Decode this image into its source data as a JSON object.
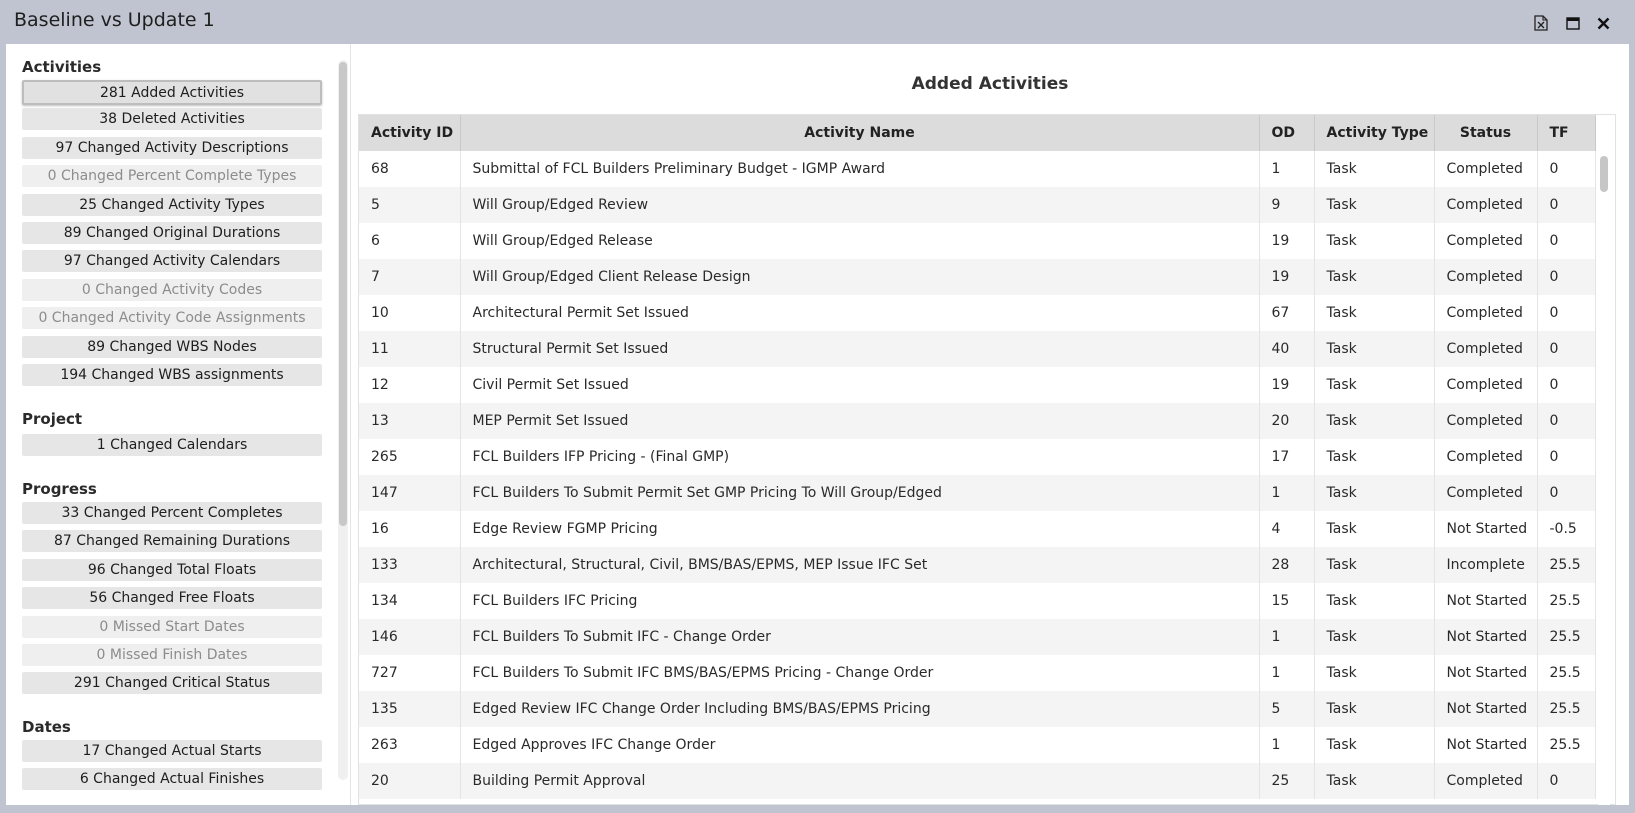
{
  "window": {
    "title": "Baseline vs Update 1"
  },
  "sidebar": {
    "sections": [
      {
        "heading": "Activities",
        "items": [
          {
            "label": "281 Added Activities",
            "state": "selected"
          },
          {
            "label": "38 Deleted Activities",
            "state": "enabled"
          },
          {
            "label": "97 Changed Activity Descriptions",
            "state": "enabled"
          },
          {
            "label": "0 Changed Percent Complete Types",
            "state": "disabled"
          },
          {
            "label": "25 Changed Activity Types",
            "state": "enabled"
          },
          {
            "label": "89 Changed Original Durations",
            "state": "enabled"
          },
          {
            "label": "97 Changed Activity Calendars",
            "state": "enabled"
          },
          {
            "label": "0 Changed Activity Codes",
            "state": "disabled"
          },
          {
            "label": "0 Changed Activity Code Assignments",
            "state": "disabled"
          },
          {
            "label": "89 Changed WBS Nodes",
            "state": "enabled"
          },
          {
            "label": "194 Changed WBS assignments",
            "state": "enabled"
          }
        ]
      },
      {
        "heading": "Project",
        "items": [
          {
            "label": "1 Changed Calendars",
            "state": "enabled"
          }
        ]
      },
      {
        "heading": "Progress",
        "items": [
          {
            "label": "33 Changed Percent Completes",
            "state": "enabled"
          },
          {
            "label": "87 Changed Remaining Durations",
            "state": "enabled"
          },
          {
            "label": "96 Changed Total Floats",
            "state": "enabled"
          },
          {
            "label": "56 Changed Free Floats",
            "state": "enabled"
          },
          {
            "label": "0 Missed Start Dates",
            "state": "disabled"
          },
          {
            "label": "0 Missed Finish Dates",
            "state": "disabled"
          },
          {
            "label": "291 Changed Critical Status",
            "state": "enabled"
          }
        ]
      },
      {
        "heading": "Dates",
        "items": [
          {
            "label": "17 Changed Actual Starts",
            "state": "enabled"
          },
          {
            "label": "6 Changed Actual Finishes",
            "state": "enabled"
          }
        ]
      }
    ]
  },
  "main": {
    "title": "Added Activities",
    "columns": [
      "Activity ID",
      "Activity Name",
      "OD",
      "Activity Type",
      "Status",
      "TF"
    ],
    "rows": [
      [
        "68",
        "Submittal of FCL Builders Preliminary Budget - IGMP Award",
        "1",
        "Task",
        "Completed",
        "0"
      ],
      [
        "5",
        "Will Group/Edged Review",
        "9",
        "Task",
        "Completed",
        "0"
      ],
      [
        "6",
        "Will Group/Edged Release",
        "19",
        "Task",
        "Completed",
        "0"
      ],
      [
        "7",
        "Will Group/Edged Client Release Design",
        "19",
        "Task",
        "Completed",
        "0"
      ],
      [
        "10",
        "Architectural Permit Set Issued",
        "67",
        "Task",
        "Completed",
        "0"
      ],
      [
        "11",
        "Structural Permit Set Issued",
        "40",
        "Task",
        "Completed",
        "0"
      ],
      [
        "12",
        "Civil Permit Set Issued",
        "19",
        "Task",
        "Completed",
        "0"
      ],
      [
        "13",
        "MEP Permit Set Issued",
        "20",
        "Task",
        "Completed",
        "0"
      ],
      [
        "265",
        "FCL Builders IFP Pricing - (Final GMP)",
        "17",
        "Task",
        "Completed",
        "0"
      ],
      [
        "147",
        "FCL Builders To Submit Permit Set GMP Pricing To Will Group/Edged",
        "1",
        "Task",
        "Completed",
        "0"
      ],
      [
        "16",
        "Edge Review FGMP Pricing",
        "4",
        "Task",
        "Not Started",
        "-0.5"
      ],
      [
        "133",
        "Architectural, Structural, Civil, BMS/BAS/EPMS, MEP Issue IFC Set",
        "28",
        "Task",
        "Incomplete",
        "25.5"
      ],
      [
        "134",
        "FCL Builders IFC Pricing",
        "15",
        "Task",
        "Not Started",
        "25.5"
      ],
      [
        "146",
        "FCL Builders To Submit IFC - Change Order",
        "1",
        "Task",
        "Not Started",
        "25.5"
      ],
      [
        "727",
        "FCL Builders To Submit IFC BMS/BAS/EPMS Pricing - Change Order",
        "1",
        "Task",
        "Not Started",
        "25.5"
      ],
      [
        "135",
        "Edged Review IFC Change Order Including BMS/BAS/EPMS Pricing",
        "5",
        "Task",
        "Not Started",
        "25.5"
      ],
      [
        "263",
        "Edged Approves IFC Change Order",
        "1",
        "Task",
        "Not Started",
        "25.5"
      ],
      [
        "20",
        "Building Permit Approval",
        "25",
        "Task",
        "Completed",
        "0"
      ]
    ]
  },
  "icons": {
    "export": "excel-export-icon",
    "maximize": "maximize-icon",
    "close": "close-icon"
  }
}
